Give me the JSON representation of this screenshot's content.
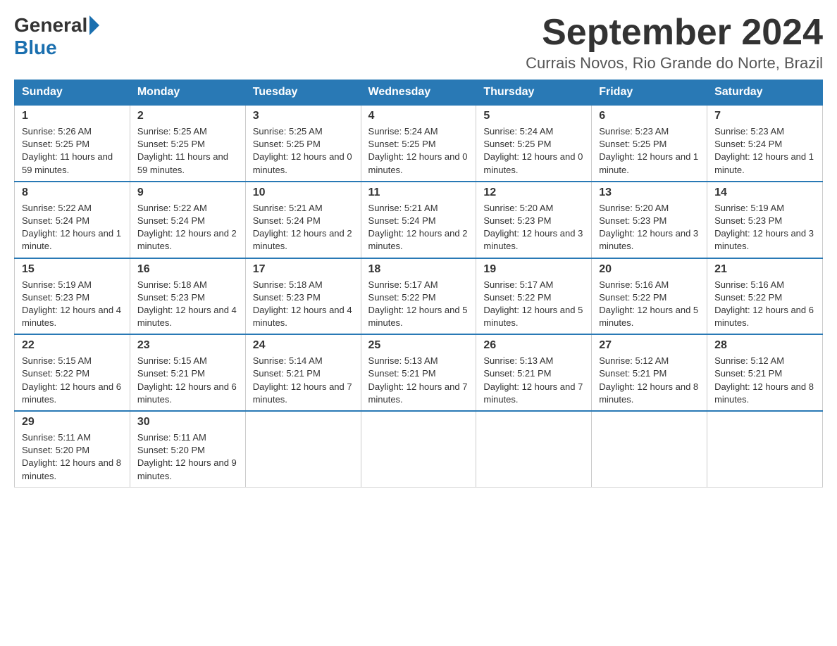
{
  "header": {
    "logo": {
      "general": "General",
      "blue": "Blue"
    },
    "title": "September 2024",
    "location": "Currais Novos, Rio Grande do Norte, Brazil"
  },
  "days_of_week": [
    "Sunday",
    "Monday",
    "Tuesday",
    "Wednesday",
    "Thursday",
    "Friday",
    "Saturday"
  ],
  "weeks": [
    [
      {
        "day": "1",
        "sunrise": "5:26 AM",
        "sunset": "5:25 PM",
        "daylight": "11 hours and 59 minutes."
      },
      {
        "day": "2",
        "sunrise": "5:25 AM",
        "sunset": "5:25 PM",
        "daylight": "11 hours and 59 minutes."
      },
      {
        "day": "3",
        "sunrise": "5:25 AM",
        "sunset": "5:25 PM",
        "daylight": "12 hours and 0 minutes."
      },
      {
        "day": "4",
        "sunrise": "5:24 AM",
        "sunset": "5:25 PM",
        "daylight": "12 hours and 0 minutes."
      },
      {
        "day": "5",
        "sunrise": "5:24 AM",
        "sunset": "5:25 PM",
        "daylight": "12 hours and 0 minutes."
      },
      {
        "day": "6",
        "sunrise": "5:23 AM",
        "sunset": "5:25 PM",
        "daylight": "12 hours and 1 minute."
      },
      {
        "day": "7",
        "sunrise": "5:23 AM",
        "sunset": "5:24 PM",
        "daylight": "12 hours and 1 minute."
      }
    ],
    [
      {
        "day": "8",
        "sunrise": "5:22 AM",
        "sunset": "5:24 PM",
        "daylight": "12 hours and 1 minute."
      },
      {
        "day": "9",
        "sunrise": "5:22 AM",
        "sunset": "5:24 PM",
        "daylight": "12 hours and 2 minutes."
      },
      {
        "day": "10",
        "sunrise": "5:21 AM",
        "sunset": "5:24 PM",
        "daylight": "12 hours and 2 minutes."
      },
      {
        "day": "11",
        "sunrise": "5:21 AM",
        "sunset": "5:24 PM",
        "daylight": "12 hours and 2 minutes."
      },
      {
        "day": "12",
        "sunrise": "5:20 AM",
        "sunset": "5:23 PM",
        "daylight": "12 hours and 3 minutes."
      },
      {
        "day": "13",
        "sunrise": "5:20 AM",
        "sunset": "5:23 PM",
        "daylight": "12 hours and 3 minutes."
      },
      {
        "day": "14",
        "sunrise": "5:19 AM",
        "sunset": "5:23 PM",
        "daylight": "12 hours and 3 minutes."
      }
    ],
    [
      {
        "day": "15",
        "sunrise": "5:19 AM",
        "sunset": "5:23 PM",
        "daylight": "12 hours and 4 minutes."
      },
      {
        "day": "16",
        "sunrise": "5:18 AM",
        "sunset": "5:23 PM",
        "daylight": "12 hours and 4 minutes."
      },
      {
        "day": "17",
        "sunrise": "5:18 AM",
        "sunset": "5:23 PM",
        "daylight": "12 hours and 4 minutes."
      },
      {
        "day": "18",
        "sunrise": "5:17 AM",
        "sunset": "5:22 PM",
        "daylight": "12 hours and 5 minutes."
      },
      {
        "day": "19",
        "sunrise": "5:17 AM",
        "sunset": "5:22 PM",
        "daylight": "12 hours and 5 minutes."
      },
      {
        "day": "20",
        "sunrise": "5:16 AM",
        "sunset": "5:22 PM",
        "daylight": "12 hours and 5 minutes."
      },
      {
        "day": "21",
        "sunrise": "5:16 AM",
        "sunset": "5:22 PM",
        "daylight": "12 hours and 6 minutes."
      }
    ],
    [
      {
        "day": "22",
        "sunrise": "5:15 AM",
        "sunset": "5:22 PM",
        "daylight": "12 hours and 6 minutes."
      },
      {
        "day": "23",
        "sunrise": "5:15 AM",
        "sunset": "5:21 PM",
        "daylight": "12 hours and 6 minutes."
      },
      {
        "day": "24",
        "sunrise": "5:14 AM",
        "sunset": "5:21 PM",
        "daylight": "12 hours and 7 minutes."
      },
      {
        "day": "25",
        "sunrise": "5:13 AM",
        "sunset": "5:21 PM",
        "daylight": "12 hours and 7 minutes."
      },
      {
        "day": "26",
        "sunrise": "5:13 AM",
        "sunset": "5:21 PM",
        "daylight": "12 hours and 7 minutes."
      },
      {
        "day": "27",
        "sunrise": "5:12 AM",
        "sunset": "5:21 PM",
        "daylight": "12 hours and 8 minutes."
      },
      {
        "day": "28",
        "sunrise": "5:12 AM",
        "sunset": "5:21 PM",
        "daylight": "12 hours and 8 minutes."
      }
    ],
    [
      {
        "day": "29",
        "sunrise": "5:11 AM",
        "sunset": "5:20 PM",
        "daylight": "12 hours and 8 minutes."
      },
      {
        "day": "30",
        "sunrise": "5:11 AM",
        "sunset": "5:20 PM",
        "daylight": "12 hours and 9 minutes."
      },
      null,
      null,
      null,
      null,
      null
    ]
  ]
}
